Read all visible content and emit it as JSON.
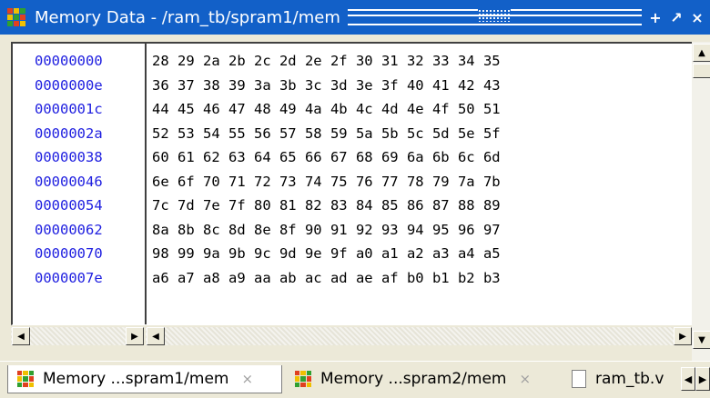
{
  "window": {
    "title": "Memory Data - /ram_tb/spram1/mem",
    "buttons": {
      "maximize": "+",
      "restore": "↗",
      "close": "×"
    }
  },
  "memory": {
    "addresses": [
      "00000000",
      "0000000e",
      "0000001c",
      "0000002a",
      "00000038",
      "00000046",
      "00000054",
      "00000062",
      "00000070",
      "0000007e"
    ],
    "rows": [
      "28 29 2a 2b 2c 2d 2e 2f 30 31 32 33 34 35",
      "36 37 38 39 3a 3b 3c 3d 3e 3f 40 41 42 43",
      "44 45 46 47 48 49 4a 4b 4c 4d 4e 4f 50 51",
      "52 53 54 55 56 57 58 59 5a 5b 5c 5d 5e 5f",
      "60 61 62 63 64 65 66 67 68 69 6a 6b 6c 6d",
      "6e 6f 70 71 72 73 74 75 76 77 78 79 7a 7b",
      "7c 7d 7e 7f 80 81 82 83 84 85 86 87 88 89",
      "8a 8b 8c 8d 8e 8f 90 91 92 93 94 95 96 97",
      "98 99 9a 9b 9c 9d 9e 9f a0 a1 a2 a3 a4 a5",
      "a6 a7 a8 a9 aa ab ac ad ae af b0 b1 b2 b3"
    ]
  },
  "tabs": [
    {
      "label": "Memory ...spram1/mem",
      "close": "×",
      "icon": "memory-grid-icon",
      "active": true
    },
    {
      "label": "Memory ...spram2/mem",
      "close": "×",
      "icon": "memory-grid-icon",
      "active": false
    },
    {
      "label": "ram_tb.v",
      "icon": "document-icon",
      "active": false
    }
  ],
  "scroll": {
    "up": "▲",
    "down": "▼",
    "left": "◀",
    "right": "▶"
  },
  "colors": {
    "title_bg": "#1260c8",
    "address_text": "#2020e0"
  }
}
